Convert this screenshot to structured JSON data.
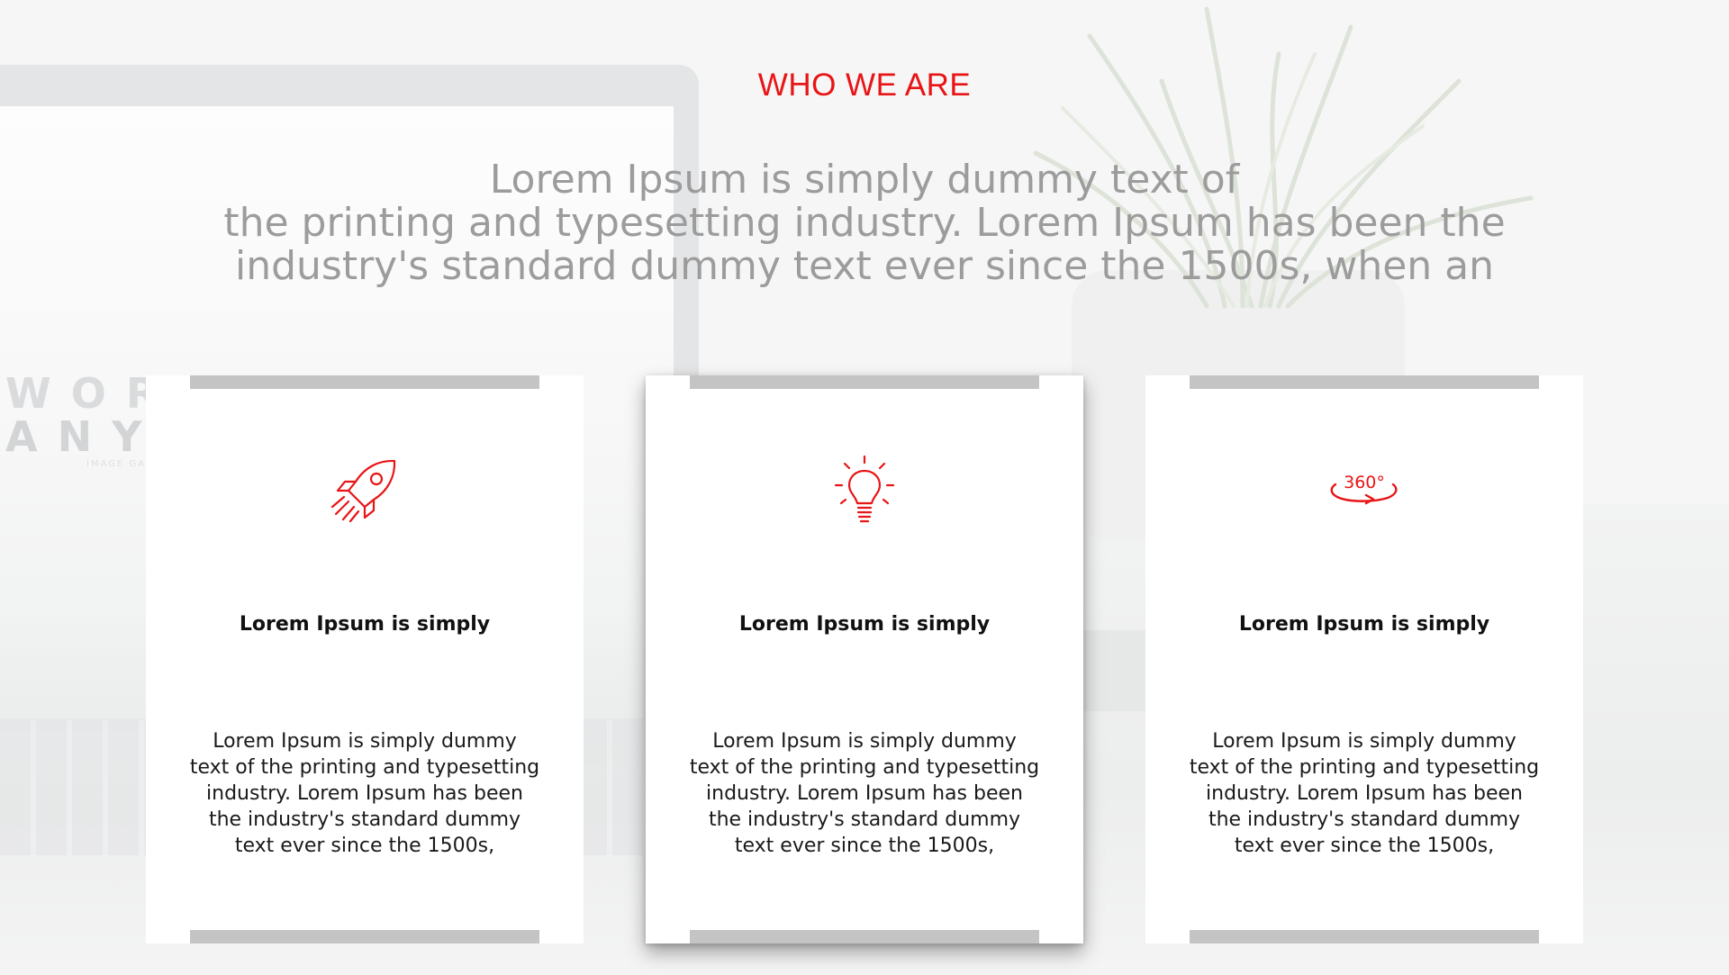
{
  "section": {
    "eyebrow": "WHO WE ARE",
    "lead_lines": [
      "Lorem Ipsum is simply dummy text of",
      "the printing and typesetting industry. Lorem Ipsum has been the",
      "industry's standard dummy text ever since the 1500s, when an"
    ]
  },
  "background": {
    "screen_line_1": "WORKWARE",
    "screen_line_2": "ANYWHERE",
    "screen_small": "IMAGE GALLERY"
  },
  "cards": [
    {
      "icon": "rocket-icon",
      "title": "Lorem Ipsum is simply",
      "text_lines": [
        "Lorem Ipsum is simply dummy",
        "text of the printing and typesetting",
        "industry. Lorem Ipsum has been",
        "the industry's standard dummy",
        "text ever since the 1500s,"
      ]
    },
    {
      "icon": "lightbulb-icon",
      "title": "Lorem Ipsum is simply",
      "text_lines": [
        "Lorem Ipsum is simply dummy",
        "text of the printing and typesetting",
        "industry. Lorem Ipsum has been",
        "the industry's standard dummy",
        "text ever since the 1500s,"
      ]
    },
    {
      "icon": "rotate-360-icon",
      "icon_label": "360°",
      "title": "Lorem Ipsum is simply",
      "text_lines": [
        "Lorem Ipsum is simply dummy",
        "text of the printing and typesetting",
        "industry. Lorem Ipsum has been",
        "the industry's standard dummy",
        "text ever since the 1500s,"
      ]
    }
  ],
  "colors": {
    "accent": "#e81416",
    "lead_text": "#9c9c9c",
    "card_bar": "#c4c4c4",
    "card_bg": "#ffffff"
  }
}
